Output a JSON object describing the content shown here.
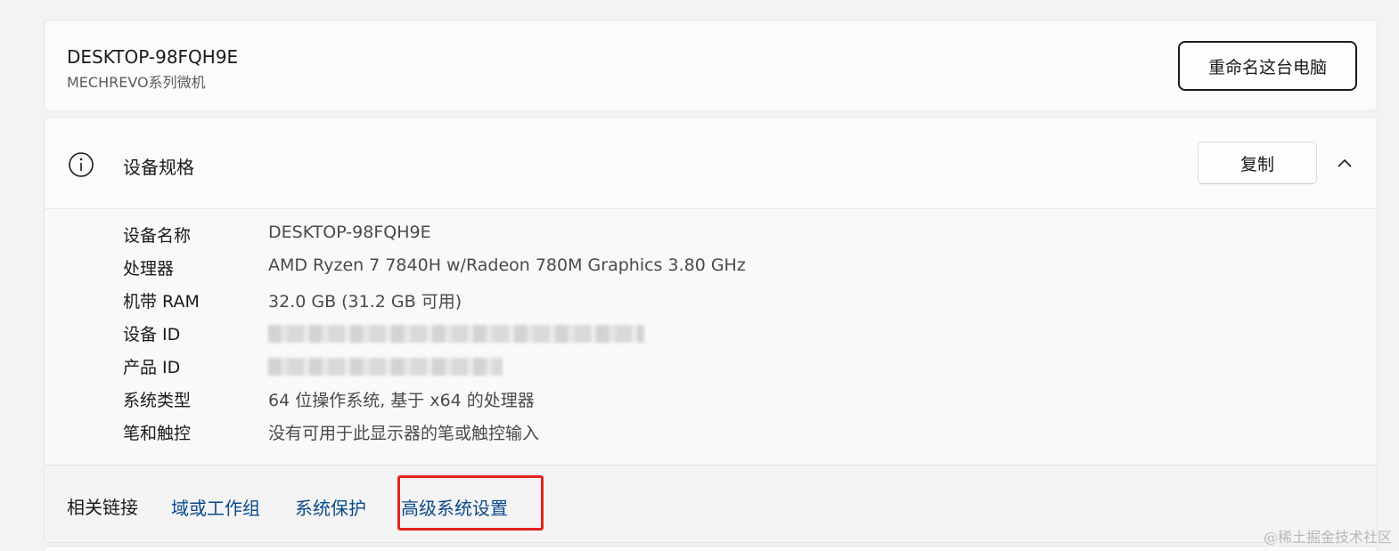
{
  "device": {
    "name": "DESKTOP-98FQH9E",
    "model": "MECHREVO系列微机",
    "rename_button": "重命名这台电脑"
  },
  "specs": {
    "title": "设备规格",
    "copy_button": "复制",
    "rows": [
      {
        "label": "设备名称",
        "value": "DESKTOP-98FQH9E"
      },
      {
        "label": "处理器",
        "value": "AMD Ryzen 7 7840H w/Radeon 780M Graphics   3.80 GHz"
      },
      {
        "label": "机带 RAM",
        "value": "32.0 GB (31.2 GB 可用)"
      },
      {
        "label": "设备 ID",
        "value": ""
      },
      {
        "label": "产品 ID",
        "value": ""
      },
      {
        "label": "系统类型",
        "value": "64 位操作系统, 基于 x64 的处理器"
      },
      {
        "label": "笔和触控",
        "value": "没有可用于此显示器的笔或触控输入"
      }
    ]
  },
  "related": {
    "label": "相关链接",
    "links": [
      "域或工作组",
      "系统保护",
      "高级系统设置"
    ]
  },
  "icons": {
    "info": "info-icon",
    "chevron": "chevron-up-icon"
  },
  "colors": {
    "link": "#0a4a8a",
    "highlight": "#e3231b"
  },
  "watermark": "@稀土掘金技术社区"
}
